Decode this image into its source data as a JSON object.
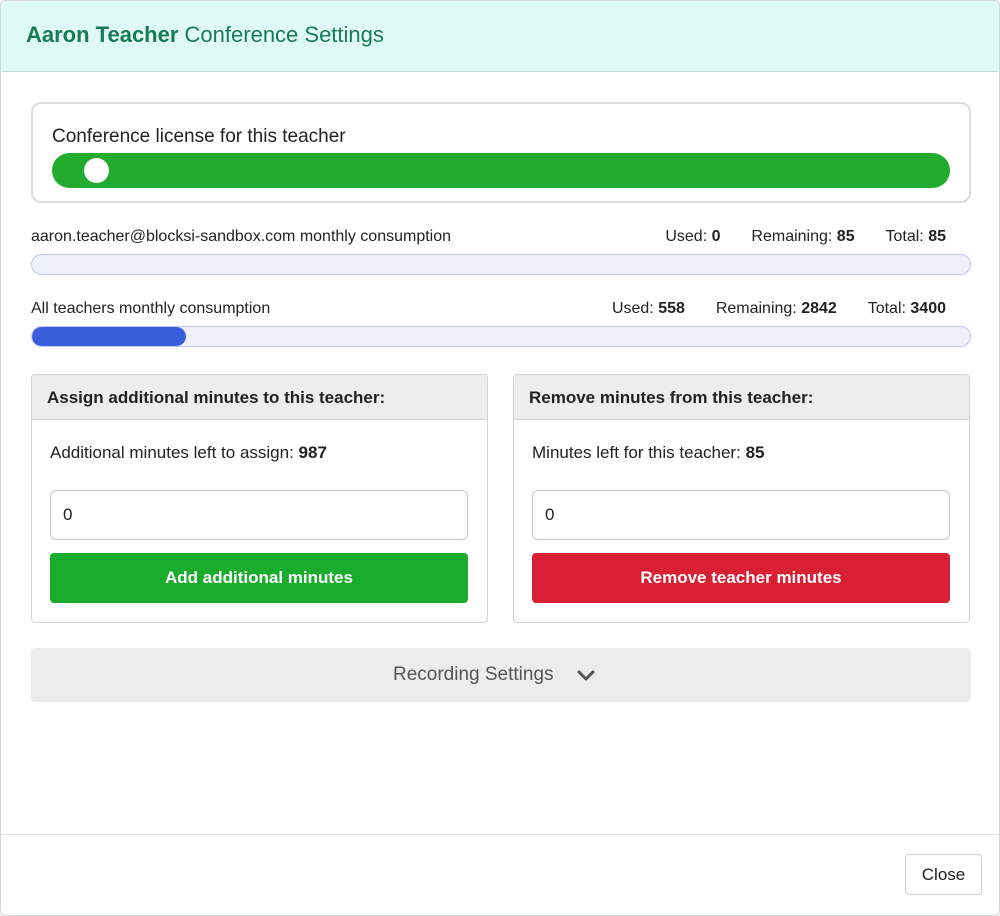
{
  "header": {
    "teacher_name": "Aaron Teacher",
    "title_suffix": "Conference Settings"
  },
  "license": {
    "label": "Conference license for this teacher",
    "enabled": true
  },
  "teacher_consumption": {
    "label": "aaron.teacher@blocksi-sandbox.com monthly consumption",
    "used_label": "Used:",
    "used": "0",
    "remaining_label": "Remaining:",
    "remaining": "85",
    "total_label": "Total:",
    "total": "85",
    "fraction_used": 0.0
  },
  "all_consumption": {
    "label": "All teachers monthly consumption",
    "used_label": "Used:",
    "used": "558",
    "remaining_label": "Remaining:",
    "remaining": "2842",
    "total_label": "Total:",
    "total": "3400",
    "fraction_used": 0.164
  },
  "assign_card": {
    "title": "Assign additional minutes to this teacher:",
    "info_label": "Additional minutes left to assign:",
    "info_value": "987",
    "input_value": "0",
    "button_label": "Add additional minutes"
  },
  "remove_card": {
    "title": "Remove minutes from this teacher:",
    "info_label": "Minutes left for this teacher:",
    "info_value": "85",
    "input_value": "0",
    "button_label": "Remove teacher minutes"
  },
  "recording": {
    "label": "Recording Settings",
    "icon": "chevron-down-icon"
  },
  "footer": {
    "close_label": "Close"
  },
  "colors": {
    "header_bg": "#dffaf6",
    "title": "#1a7a55",
    "toggle_on": "#22ac2e",
    "progress": "#3a5ddb",
    "add_button": "#1aac2d",
    "remove_button": "#d81f33"
  }
}
